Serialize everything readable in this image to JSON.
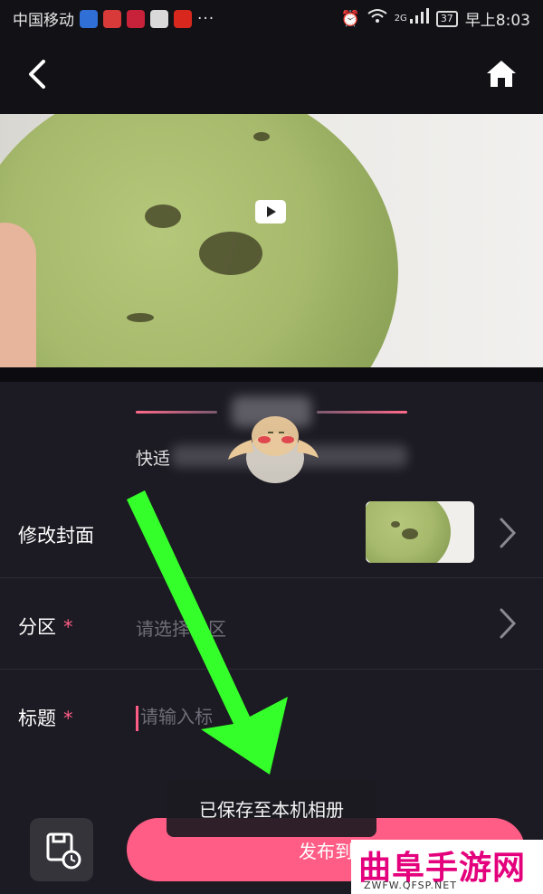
{
  "status_bar": {
    "carrier": "中国移动",
    "more": "···",
    "network": "2G",
    "battery": "37",
    "time": "早上8:03"
  },
  "nav": {
    "back_icon": "chevron-left-icon",
    "home_icon": "home-icon"
  },
  "video": {
    "play_icon": "play-icon"
  },
  "upload": {
    "tip_prefix": "快适"
  },
  "form": {
    "cover_label": "修改封面",
    "section_label": "分区",
    "section_required": "*",
    "section_placeholder": "请选择分区",
    "title_label": "标题",
    "title_required": "*",
    "title_placeholder": "请输入标"
  },
  "bottom": {
    "save_draft_icon": "save-draft-icon",
    "publish_label": "发布到"
  },
  "toast": {
    "message": "已保存至本机相册"
  },
  "watermark": {
    "title": "曲阜手游网",
    "url": "ZWFW.QFSP.NET"
  },
  "colors": {
    "accent": "#ff5d86",
    "background": "#1c1a22",
    "arrow": "#35ff2a"
  }
}
